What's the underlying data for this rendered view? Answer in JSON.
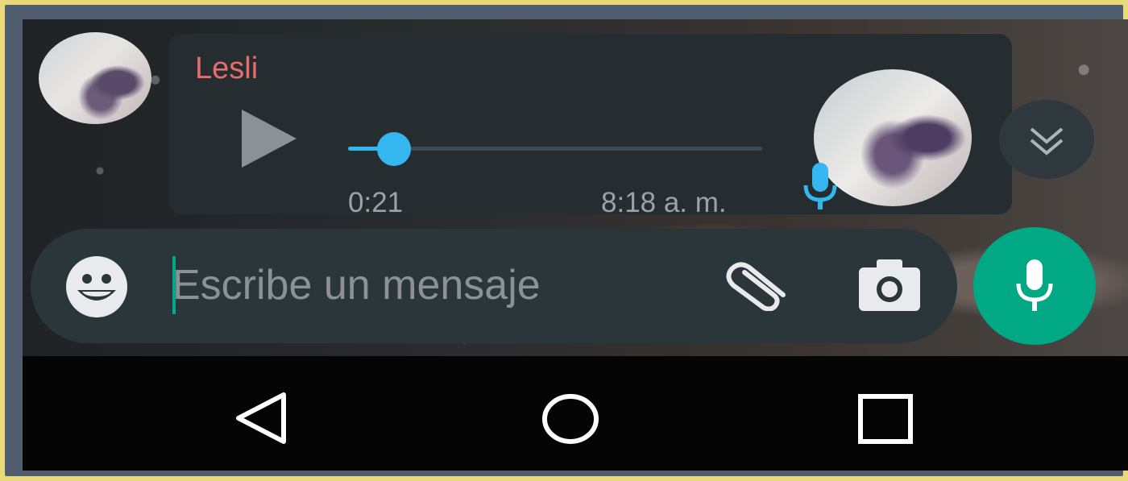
{
  "message": {
    "sender": "Lesli",
    "duration": "0:21",
    "time": "8:18 a. m.",
    "progress": 0.11
  },
  "composer": {
    "placeholder": "Escribe un mensaje"
  },
  "icons": {
    "play": "play-icon",
    "mic_status": "mic-icon",
    "scroll_down": "double-chevron-down-icon",
    "emoji": "emoji-icon",
    "attach": "paperclip-icon",
    "camera": "camera-icon",
    "send_voice": "mic-icon",
    "nav_back": "triangle-back-icon",
    "nav_home": "circle-home-icon",
    "nav_recents": "square-recents-icon"
  },
  "colors": {
    "accent": "#00a884",
    "voice_blue": "#34b7f1",
    "sender": "#e86d6f",
    "bubble": "#262d31"
  }
}
